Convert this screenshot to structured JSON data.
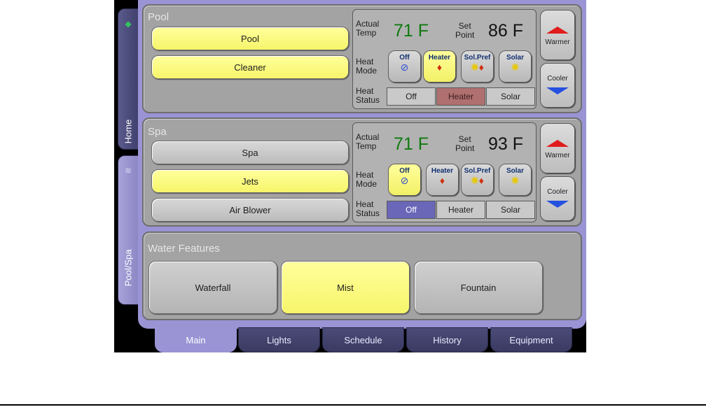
{
  "side_tabs": [
    {
      "label": "Home"
    },
    {
      "label": "Pool/Spa"
    }
  ],
  "pool": {
    "title": "Pool",
    "buttons": [
      {
        "label": "Pool",
        "on": true
      },
      {
        "label": "Cleaner",
        "on": true
      }
    ],
    "actual_temp_label": "Actual\nTemp",
    "actual_temp": "71 F",
    "set_point_label": "Set\nPoint",
    "set_point": "86 F",
    "heat_mode_label": "Heat\nMode",
    "modes": [
      {
        "label": "Off",
        "icon": "no-symbol-icon",
        "on": false
      },
      {
        "label": "Heater",
        "icon": "flame-icon",
        "on": true
      },
      {
        "label": "Sol.Pref",
        "icon": "sun-flame-icon",
        "on": false
      },
      {
        "label": "Solar",
        "icon": "sun-icon",
        "on": false
      }
    ],
    "heat_status_label": "Heat\nStatus",
    "status": [
      {
        "label": "Off",
        "active": false
      },
      {
        "label": "Heater",
        "active": true,
        "color": "#b07070"
      },
      {
        "label": "Solar",
        "active": false
      }
    ],
    "warmer_label": "Warmer",
    "cooler_label": "Cooler"
  },
  "spa": {
    "title": "Spa",
    "buttons": [
      {
        "label": "Spa",
        "on": false
      },
      {
        "label": "Jets",
        "on": true
      },
      {
        "label": "Air Blower",
        "on": false
      }
    ],
    "actual_temp_label": "Actual\nTemp",
    "actual_temp": "71 F",
    "set_point_label": "Set\nPoint",
    "set_point": "93 F",
    "heat_mode_label": "Heat\nMode",
    "modes": [
      {
        "label": "Off",
        "icon": "no-symbol-icon",
        "on": true
      },
      {
        "label": "Heater",
        "icon": "flame-icon",
        "on": false
      },
      {
        "label": "Sol.Pref",
        "icon": "sun-flame-icon",
        "on": false
      },
      {
        "label": "Solar",
        "icon": "sun-icon",
        "on": false
      }
    ],
    "heat_status_label": "Heat\nStatus",
    "status": [
      {
        "label": "Off",
        "active": true,
        "color": "#6a67b8"
      },
      {
        "label": "Heater",
        "active": false
      },
      {
        "label": "Solar",
        "active": false
      }
    ],
    "warmer_label": "Warmer",
    "cooler_label": "Cooler"
  },
  "water_features": {
    "title": "Water Features",
    "buttons": [
      {
        "label": "Waterfall",
        "on": false
      },
      {
        "label": "Mist",
        "on": true
      },
      {
        "label": "Fountain",
        "on": false
      }
    ]
  },
  "bottom_tabs": [
    {
      "label": "Main",
      "active": true
    },
    {
      "label": "Lights",
      "active": false
    },
    {
      "label": "Schedule",
      "active": false
    },
    {
      "label": "History",
      "active": false
    },
    {
      "label": "Equipment",
      "active": false
    }
  ],
  "colors": {
    "on_yellow": "#f7f56a",
    "frame_purple": "#9a93d4",
    "temp_green": "#0f7a0f",
    "warmer_red": "#e01c1c",
    "cooler_blue": "#2550e0"
  }
}
